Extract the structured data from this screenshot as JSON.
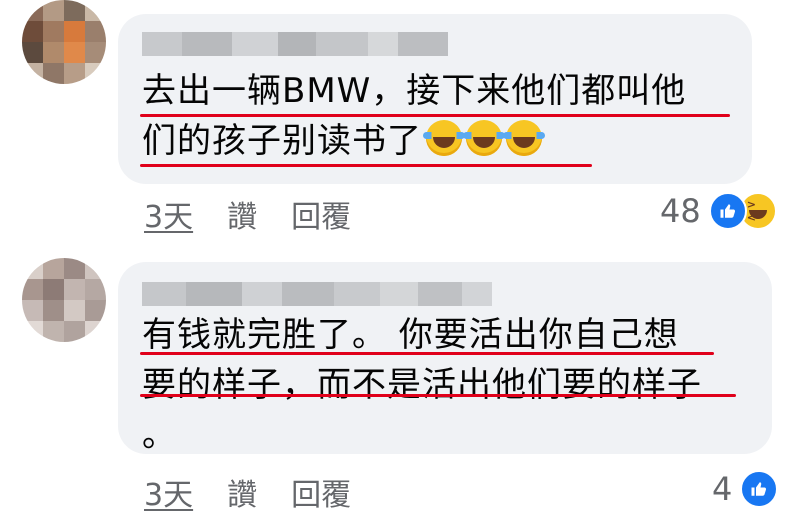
{
  "comments": [
    {
      "text_lines": [
        "去出一辆BMW，接下来他们都叫他",
        "们的孩子别读书了"
      ],
      "emojis": [
        "face-with-tears-of-joy-icon",
        "face-with-tears-of-joy-icon",
        "face-with-tears-of-joy-icon"
      ],
      "time": "3天",
      "like_label": "讚",
      "reply_label": "回覆",
      "reaction_count": "48",
      "reactions": [
        "like-icon",
        "haha-icon"
      ]
    },
    {
      "text_lines": [
        "有钱就完胜了。 你要活出你自己想",
        "要的样子，而不是活出他们要的样子",
        "。"
      ],
      "time": "3天",
      "like_label": "讚",
      "reply_label": "回覆",
      "reaction_count": "4",
      "reactions": [
        "like-icon"
      ]
    }
  ],
  "colors": {
    "bubble": "#f0f2f5",
    "underline": "#e0001a",
    "meta": "#65676b",
    "like_blue": "#1877f2"
  }
}
